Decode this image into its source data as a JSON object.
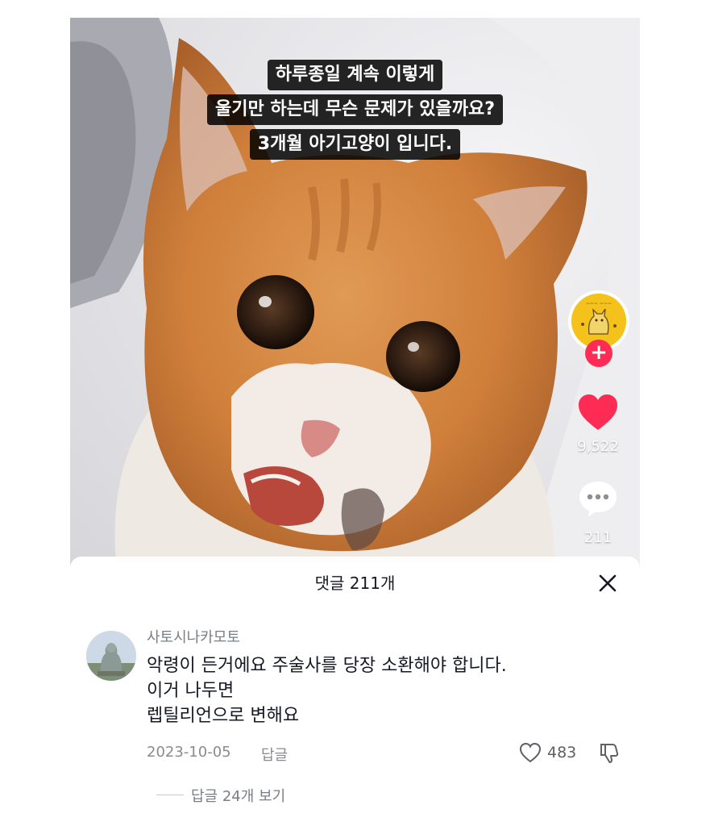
{
  "video": {
    "caption_lines": [
      "하루종일 계속 이렇게",
      "울기만 하는데 무슨 문제가 있을까요?",
      "3개월 아기고양이 입니다."
    ],
    "likes": "9,522",
    "comments": "211",
    "icons": {
      "avatar": "creator-avatar-icon",
      "follow": "plus-icon",
      "like": "heart-icon",
      "comment": "speech-bubble-icon"
    },
    "colors": {
      "like": "#fe2c55",
      "follow": "#fe2c55"
    }
  },
  "sheet": {
    "title": "댓글 211개",
    "close_icon": "close-icon"
  },
  "comment": {
    "username": "사토시나카모토",
    "text_lines": [
      "악령이 든거에요 주술사를 당장 소환해야 합니다.",
      "이거 나두면",
      "렙틸리언으로 변해요"
    ],
    "date": "2023-10-05",
    "reply_label": "답글",
    "like_count": "483",
    "view_replies": "답글 24개 보기"
  }
}
